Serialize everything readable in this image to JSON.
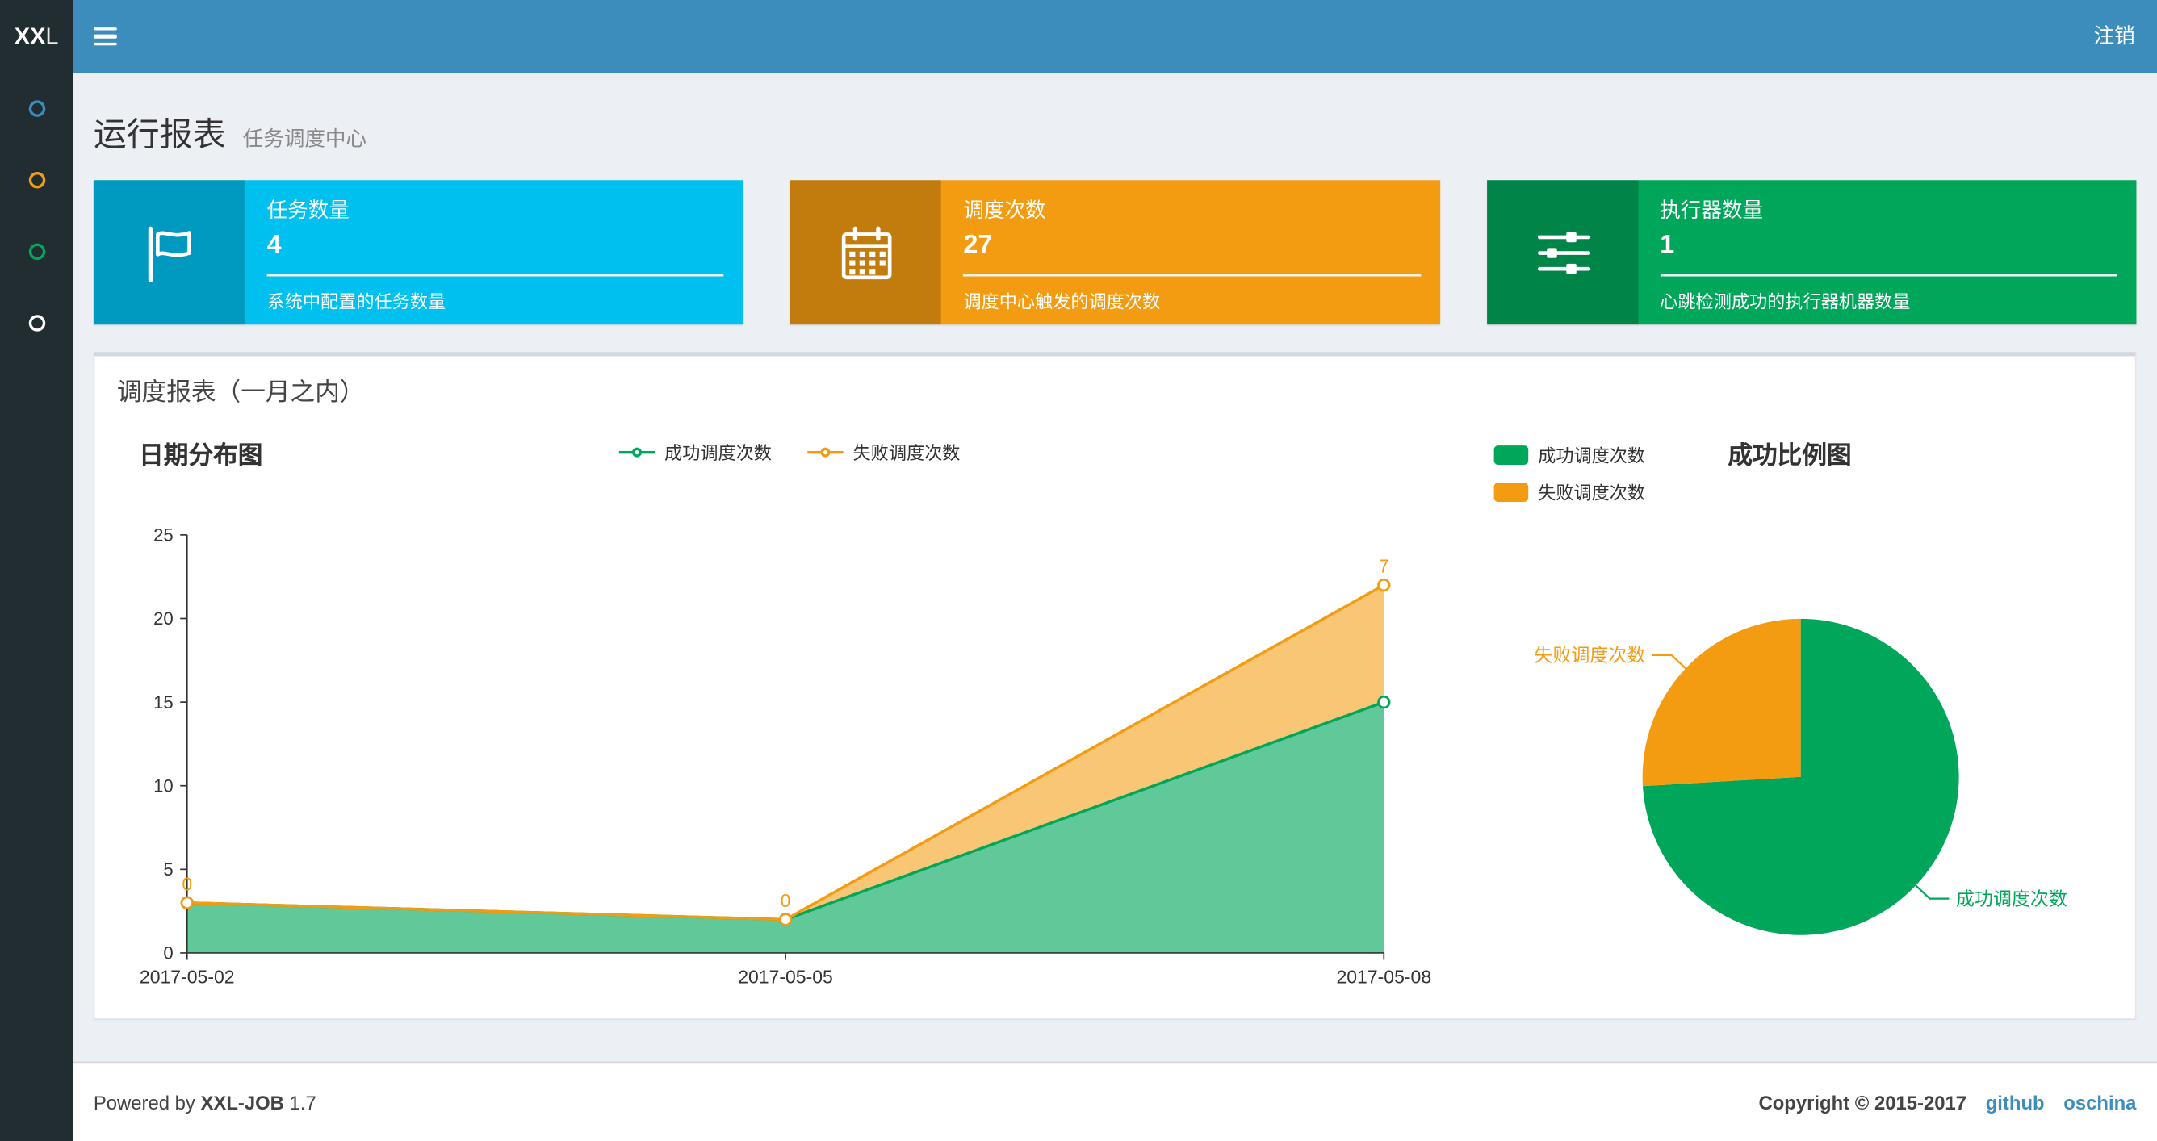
{
  "navbar": {
    "logo_bold": "XX",
    "logo_rest": "L",
    "logout": "注销"
  },
  "sidebar": {
    "items": [
      {
        "label": "menu-item-1",
        "color": "#3c8dbc"
      },
      {
        "label": "menu-item-2",
        "color": "#f39c12"
      },
      {
        "label": "menu-item-3",
        "color": "#00a65a"
      },
      {
        "label": "menu-item-4",
        "color": "#ffffff"
      }
    ]
  },
  "header": {
    "title": "运行报表",
    "subtitle": "任务调度中心"
  },
  "infoboxes": [
    {
      "title": "任务数量",
      "value": "4",
      "desc": "系统中配置的任务数量",
      "bg": "#00c0ef",
      "icon": "flag-icon"
    },
    {
      "title": "调度次数",
      "value": "27",
      "desc": "调度中心触发的调度次数",
      "bg": "#f39c12",
      "icon": "calendar-icon"
    },
    {
      "title": "执行器数量",
      "value": "1",
      "desc": "心跳检测成功的执行器机器数量",
      "bg": "#00a65a",
      "icon": "sliders-icon"
    }
  ],
  "panel": {
    "title": "调度报表（一月之内）"
  },
  "chart_data": [
    {
      "type": "area",
      "title": "日期分布图",
      "categories": [
        "2017-05-02",
        "2017-05-05",
        "2017-05-08"
      ],
      "series": [
        {
          "name": "成功调度次数",
          "color": "#00a65a",
          "values": [
            3,
            2,
            15
          ]
        },
        {
          "name": "失败调度次数",
          "color": "#f39c12",
          "values": [
            0,
            0,
            7
          ],
          "labels": [
            "0",
            "0",
            "7"
          ]
        }
      ],
      "stacked": true,
      "ylim": [
        0,
        25
      ],
      "yticks": [
        0,
        5,
        10,
        15,
        20,
        25
      ],
      "legend_position": "top",
      "grid": false
    },
    {
      "type": "pie",
      "title": "成功比例图",
      "slices": [
        {
          "name": "成功调度次数",
          "value": 20,
          "color": "#00a65a"
        },
        {
          "name": "失败调度次数",
          "value": 7,
          "color": "#f39c12"
        }
      ],
      "legend_position": "top-left"
    }
  ],
  "footer": {
    "powered_prefix": "Powered by",
    "product": "XXL-JOB",
    "version": "1.7",
    "copyright": "Copyright © 2015-2017",
    "links": [
      "github",
      "oschina"
    ]
  }
}
